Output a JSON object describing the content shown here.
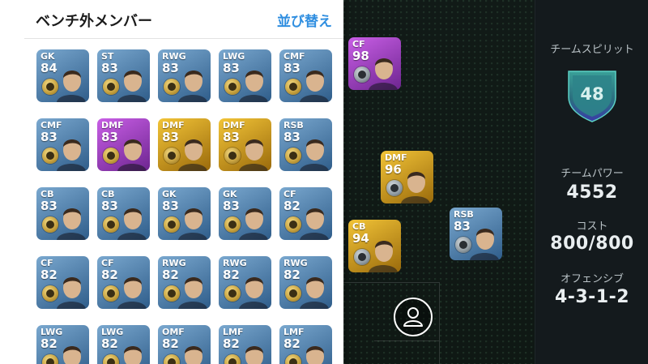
{
  "bench": {
    "title": "ベンチ外メンバー",
    "sort_label": "並び替え",
    "players": [
      {
        "pos": "GK",
        "ovr": "84",
        "theme": "blue"
      },
      {
        "pos": "ST",
        "ovr": "83",
        "theme": "blue"
      },
      {
        "pos": "RWG",
        "ovr": "83",
        "theme": "blue"
      },
      {
        "pos": "LWG",
        "ovr": "83",
        "theme": "blue"
      },
      {
        "pos": "CMF",
        "ovr": "83",
        "theme": "blue"
      },
      {
        "pos": "CMF",
        "ovr": "83",
        "theme": "blue"
      },
      {
        "pos": "DMF",
        "ovr": "83",
        "theme": "purple"
      },
      {
        "pos": "DMF",
        "ovr": "83",
        "theme": "gold"
      },
      {
        "pos": "DMF",
        "ovr": "83",
        "theme": "gold"
      },
      {
        "pos": "RSB",
        "ovr": "83",
        "theme": "blue"
      },
      {
        "pos": "CB",
        "ovr": "83",
        "theme": "blue"
      },
      {
        "pos": "CB",
        "ovr": "83",
        "theme": "blue"
      },
      {
        "pos": "GK",
        "ovr": "83",
        "theme": "blue"
      },
      {
        "pos": "GK",
        "ovr": "83",
        "theme": "blue"
      },
      {
        "pos": "CF",
        "ovr": "82",
        "theme": "blue"
      },
      {
        "pos": "CF",
        "ovr": "82",
        "theme": "blue"
      },
      {
        "pos": "CF",
        "ovr": "82",
        "theme": "blue"
      },
      {
        "pos": "RWG",
        "ovr": "82",
        "theme": "blue"
      },
      {
        "pos": "RWG",
        "ovr": "82",
        "theme": "blue"
      },
      {
        "pos": "RWG",
        "ovr": "82",
        "theme": "blue"
      },
      {
        "pos": "LWG",
        "ovr": "82",
        "theme": "blue"
      },
      {
        "pos": "LWG",
        "ovr": "82",
        "theme": "blue"
      },
      {
        "pos": "OMF",
        "ovr": "82",
        "theme": "blue"
      },
      {
        "pos": "LMF",
        "ovr": "82",
        "theme": "blue"
      },
      {
        "pos": "LMF",
        "ovr": "82",
        "theme": "blue"
      }
    ]
  },
  "pitch": {
    "players": [
      {
        "pos": "CF",
        "ovr": "98",
        "theme": "purple"
      },
      {
        "pos": "DMF",
        "ovr": "96",
        "theme": "gold"
      },
      {
        "pos": "RSB",
        "ovr": "83",
        "theme": "blue"
      },
      {
        "pos": "CB",
        "ovr": "94",
        "theme": "gold"
      }
    ]
  },
  "stats": {
    "team_spirit_label": "チームスピリット",
    "team_spirit_value": "48",
    "team_power_label": "チームパワー",
    "team_power_value": "4552",
    "cost_label": "コスト",
    "cost_value": "800/800",
    "formation_label": "オフェンシブ",
    "formation_value": "4-3-1-2"
  },
  "colors": {
    "blue": [
      "#7aa8cf",
      "#2f5d8a"
    ],
    "purple": [
      "#c95fe6",
      "#6d2590"
    ],
    "gold": [
      "#f2c437",
      "#9a6a0c"
    ],
    "accent": "#2f8ee0",
    "spirit_shield": "#2a7d7a"
  },
  "icons": {
    "view_toggle": "person-icon",
    "badge": "team-badge-icon"
  }
}
